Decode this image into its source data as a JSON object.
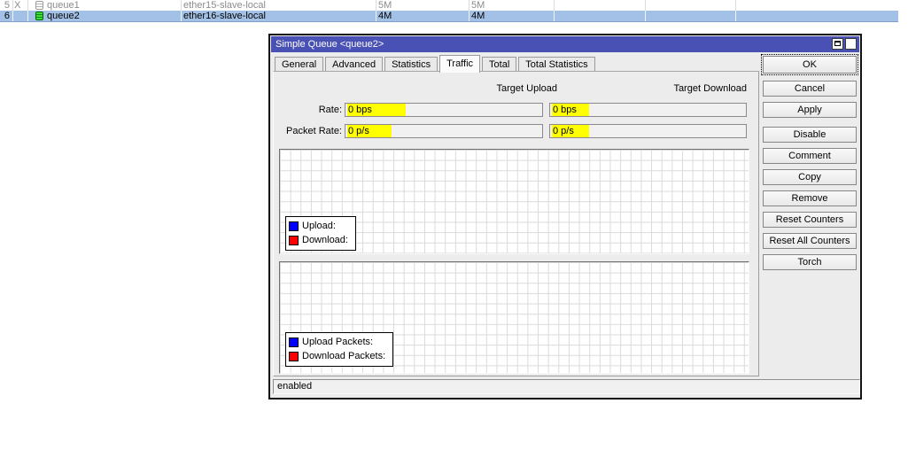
{
  "queue_table": {
    "rows": [
      {
        "number": "5",
        "disabled_flag": "X",
        "name": "queue1",
        "target": "ether15-slave-local",
        "max_upload": "5M",
        "max_download": "5M"
      },
      {
        "number": "6",
        "disabled_flag": "",
        "name": "queue2",
        "target": "ether16-slave-local",
        "max_upload": "4M",
        "max_download": "4M"
      }
    ],
    "selected_row_color": "#a3c1e6",
    "disabled_text_color": "#8b8b8b"
  },
  "dialog": {
    "title": "Simple Queue <queue2>",
    "titlebar_color": "#4a51b4",
    "icons": {
      "close_glyph": "✕",
      "maximize": "maximize-icon"
    },
    "tabs": [
      "General",
      "Advanced",
      "Statistics",
      "Traffic",
      "Total",
      "Total Statistics"
    ],
    "active_tab": "Traffic",
    "column_headers": {
      "upload": "Target Upload",
      "download": "Target Download"
    },
    "rate_row": {
      "label": "Rate:",
      "upload_value": "0 bps",
      "download_value": "0 bps"
    },
    "packet_rate_row": {
      "label": "Packet Rate:",
      "upload_value": "0 p/s",
      "download_value": "0 p/s"
    },
    "highlight_color": "#ffff00",
    "rate_graph_legend": [
      {
        "label": "Upload:",
        "color": "#0000ff"
      },
      {
        "label": "Download:",
        "color": "#ff0000"
      }
    ],
    "packet_graph_legend": [
      {
        "label": "Upload Packets:",
        "color": "#0000ff"
      },
      {
        "label": "Download Packets:",
        "color": "#ff0000"
      }
    ],
    "action_buttons": [
      "OK",
      "Cancel",
      "Apply",
      "Disable",
      "Comment",
      "Copy",
      "Remove",
      "Reset Counters",
      "Reset All Counters",
      "Torch"
    ],
    "status_text": "enabled"
  }
}
